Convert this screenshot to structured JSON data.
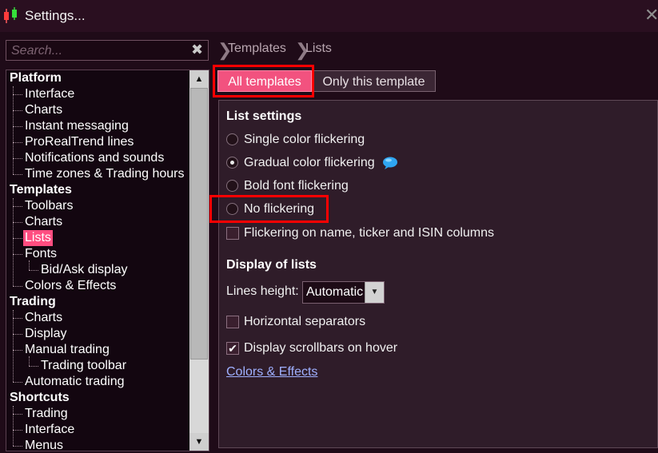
{
  "window": {
    "title": "Settings...",
    "close_icon": "close-icon",
    "app_icon": "candlestick-chart-icon"
  },
  "search": {
    "placeholder": "Search...",
    "value": "",
    "clear_icon": "clear-x-icon"
  },
  "tree": {
    "items": [
      {
        "label": "Platform",
        "level": 0
      },
      {
        "label": "Interface",
        "level": 1
      },
      {
        "label": "Charts",
        "level": 1
      },
      {
        "label": "Instant messaging",
        "level": 1
      },
      {
        "label": "ProRealTrend lines",
        "level": 1
      },
      {
        "label": "Notifications and sounds",
        "level": 1
      },
      {
        "label": "Time zones & Trading hours",
        "level": 1
      },
      {
        "label": "Templates",
        "level": 0
      },
      {
        "label": "Toolbars",
        "level": 1
      },
      {
        "label": "Charts",
        "level": 1
      },
      {
        "label": "Lists",
        "level": 1,
        "selected": true
      },
      {
        "label": "Fonts",
        "level": 1
      },
      {
        "label": "Bid/Ask display",
        "level": 2
      },
      {
        "label": "Colors & Effects",
        "level": 1
      },
      {
        "label": "Trading",
        "level": 0
      },
      {
        "label": "Charts",
        "level": 1
      },
      {
        "label": "Display",
        "level": 1
      },
      {
        "label": "Manual trading",
        "level": 1
      },
      {
        "label": "Trading toolbar",
        "level": 2
      },
      {
        "label": "Automatic trading",
        "level": 1
      },
      {
        "label": "Shortcuts",
        "level": 0
      },
      {
        "label": "Trading",
        "level": 1
      },
      {
        "label": "Interface",
        "level": 1
      },
      {
        "label": "Menus",
        "level": 1
      }
    ]
  },
  "breadcrumb": {
    "items": [
      "Templates",
      "Lists"
    ]
  },
  "tabs": [
    {
      "label": "All templates",
      "active": true
    },
    {
      "label": "Only this template",
      "active": false
    }
  ],
  "list_settings": {
    "heading": "List settings",
    "options": [
      {
        "label": "Single color flickering",
        "checked": false
      },
      {
        "label": "Gradual color flickering",
        "checked": true
      },
      {
        "label": "Bold font flickering",
        "checked": false
      },
      {
        "label": "No flickering",
        "checked": false
      }
    ],
    "flicker_columns": {
      "label": "Flickering on name, ticker and ISIN columns",
      "checked": false
    }
  },
  "display_of_lists": {
    "heading": "Display of lists",
    "lines_height_label": "Lines height:",
    "lines_height_value": "Automatic",
    "horizontal_separators": {
      "label": "Horizontal separators",
      "checked": false
    },
    "scrollbars_on_hover": {
      "label": "Display scrollbars on hover",
      "checked": true
    }
  },
  "link": {
    "label": "Colors & Effects"
  },
  "colors": {
    "accent": "#f2527f",
    "highlight_box": "#ff0000",
    "link": "#9fb0ff"
  }
}
